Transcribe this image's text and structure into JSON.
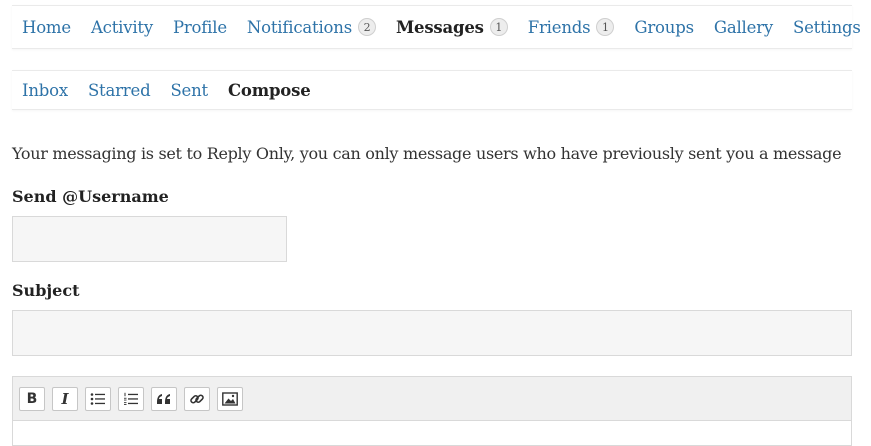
{
  "nav": {
    "items": [
      {
        "label": "Home",
        "badge": null,
        "active": false
      },
      {
        "label": "Activity",
        "badge": null,
        "active": false
      },
      {
        "label": "Profile",
        "badge": null,
        "active": false
      },
      {
        "label": "Notifications",
        "badge": "2",
        "active": false
      },
      {
        "label": "Messages",
        "badge": "1",
        "active": true
      },
      {
        "label": "Friends",
        "badge": "1",
        "active": false
      },
      {
        "label": "Groups",
        "badge": null,
        "active": false
      },
      {
        "label": "Gallery",
        "badge": null,
        "active": false
      },
      {
        "label": "Settings",
        "badge": null,
        "active": false
      }
    ]
  },
  "subnav": {
    "items": [
      {
        "label": "Inbox",
        "active": false
      },
      {
        "label": "Starred",
        "active": false
      },
      {
        "label": "Sent",
        "active": false
      },
      {
        "label": "Compose",
        "active": true
      }
    ]
  },
  "compose": {
    "notice": "Your messaging is set to Reply Only, you can only message users who have previously sent you a message",
    "username_label": "Send @Username",
    "username_value": "",
    "subject_label": "Subject",
    "subject_value": "",
    "toolbar": {
      "bold": "B",
      "italic": "I",
      "icons": [
        "bold-icon",
        "italic-icon",
        "bulleted-list-icon",
        "numbered-list-icon",
        "blockquote-icon",
        "link-icon",
        "image-icon"
      ]
    }
  },
  "colors": {
    "link": "#2e73a8",
    "active": "#222222",
    "input_bg": "#f6f6f6",
    "toolbar_bg": "#f0f0f0"
  }
}
